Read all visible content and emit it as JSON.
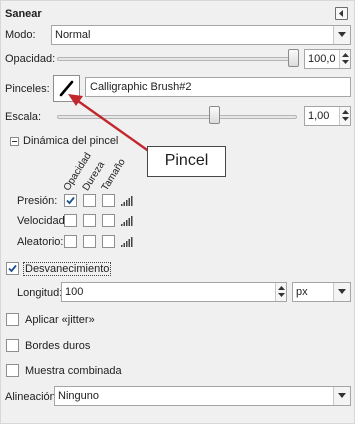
{
  "panel": {
    "title": "Sanear",
    "pin_icon": "triangle-left-icon"
  },
  "mode": {
    "label": "Modo:",
    "value": "Normal"
  },
  "opacity": {
    "label": "Opacidad:",
    "value": "100,0",
    "level_percent": 100
  },
  "brushes": {
    "label": "Pinceles:",
    "value": "Calligraphic Brush#2",
    "preview_icon": "calligraphic-stroke-icon"
  },
  "scale": {
    "label": "Escala:",
    "value": "1,00"
  },
  "dynamics": {
    "section_label": "Dinámica del pincel",
    "columns": [
      "Opacidad",
      "Dureza",
      "Tamaño"
    ],
    "rows": [
      {
        "label": "Presión:",
        "checked": [
          true,
          false,
          false
        ]
      },
      {
        "label": "Velocidad:",
        "checked": [
          false,
          false,
          false
        ]
      },
      {
        "label": "Aleatorio:",
        "checked": [
          false,
          false,
          false
        ]
      }
    ],
    "curve_icon": "signal-bars-icon"
  },
  "fade": {
    "label": "Desvanecimiento",
    "checked": true
  },
  "length": {
    "label": "Longitud:",
    "value": "100",
    "unit": "px"
  },
  "jitter": {
    "label": "Aplicar «jitter»",
    "checked": false
  },
  "hard_edges": {
    "label": "Bordes duros",
    "checked": false
  },
  "sample_merged": {
    "label": "Muestra combinada",
    "checked": false
  },
  "alignment": {
    "label": "Alineación:",
    "value": "Ninguno"
  },
  "callout": {
    "text": "Pincel",
    "color": "#c1272d"
  }
}
